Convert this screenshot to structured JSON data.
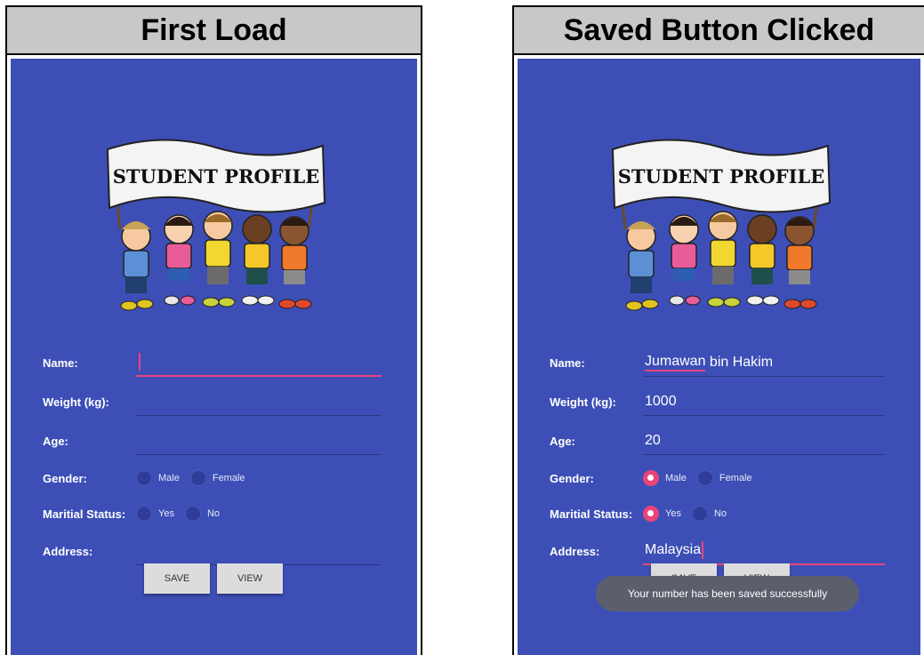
{
  "panels": {
    "left": {
      "title": "First Load"
    },
    "right": {
      "title": "Saved Button Clicked"
    }
  },
  "logo": {
    "banner_text": "STUDENT PROFILE"
  },
  "form": {
    "labels": {
      "name": "Name:",
      "weight": "Weight (kg):",
      "age": "Age:",
      "gender": "Gender:",
      "marital": "Maritial Status:",
      "address": "Address:"
    },
    "gender_options": [
      "Male",
      "Female"
    ],
    "marital_options": [
      "Yes",
      "No"
    ],
    "save_label": "SAVE",
    "view_label": "VIEW"
  },
  "first_load": {
    "name": "",
    "weight": "",
    "age": "",
    "address": ""
  },
  "saved": {
    "name_first": "Jumawan",
    "name_rest": " bin Hakim",
    "weight": "1000",
    "age": "20",
    "gender": "Male",
    "marital": "Yes",
    "address": "Malaysia",
    "toast": "Your number has been saved successfully"
  },
  "colors": {
    "background": "#3d4fb6",
    "accent": "#e8447a",
    "header": "#c8c8c8"
  }
}
